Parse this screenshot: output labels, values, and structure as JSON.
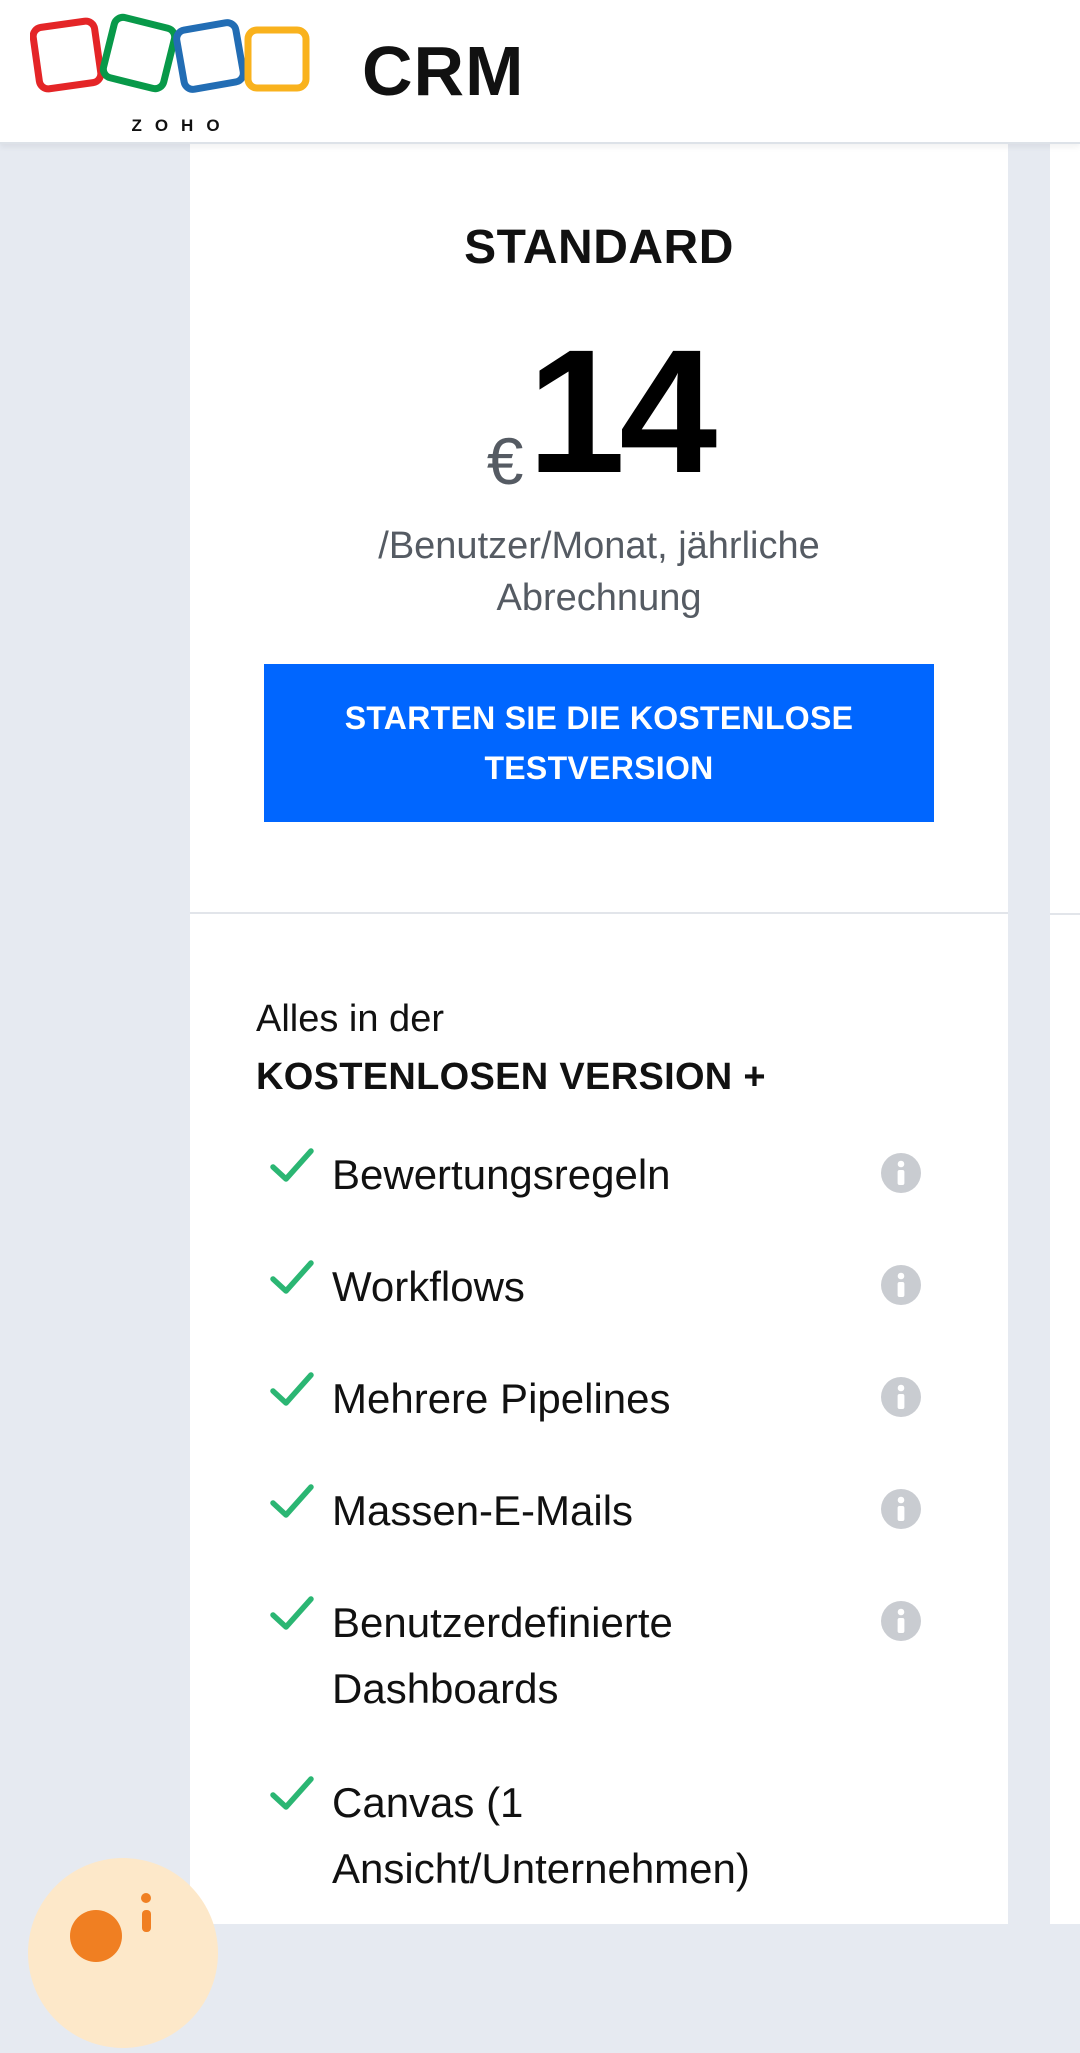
{
  "header": {
    "brand_letters": "ZOHO",
    "product_name": "CRM"
  },
  "plan": {
    "name": "STANDARD",
    "currency": "€",
    "amount": "14",
    "billing_note_line1": "/Benutzer/Monat, jährliche",
    "billing_note_line2": "Abrechnung",
    "cta_line1": "STARTEN SIE DIE KOSTENLOSE",
    "cta_line2": "TESTVERSION"
  },
  "includes": {
    "line1": "Alles in der",
    "line2": "KOSTENLOSEN VERSION +"
  },
  "features": [
    {
      "label_line1": "Bewertungsregeln",
      "label_line2": "",
      "has_info": true
    },
    {
      "label_line1": "Workflows",
      "label_line2": "",
      "has_info": true
    },
    {
      "label_line1": "Mehrere Pipelines",
      "label_line2": "",
      "has_info": true
    },
    {
      "label_line1": "Massen-E-Mails",
      "label_line2": "",
      "has_info": true
    },
    {
      "label_line1": "Benutzerdefinierte",
      "label_line2": "Dashboards",
      "has_info": true
    },
    {
      "label_line1": "Canvas (1",
      "label_line2": "Ansicht/Unternehmen)",
      "has_info": false
    }
  ],
  "colors": {
    "accent": "#0066ff",
    "check": "#2bb673",
    "logo_red": "#e42527",
    "logo_green": "#089949",
    "logo_blue": "#226db4",
    "logo_yellow": "#f9b21d"
  },
  "icons": {
    "check": "check-icon",
    "info": "info-icon",
    "chat": "chat-widget-icon"
  }
}
